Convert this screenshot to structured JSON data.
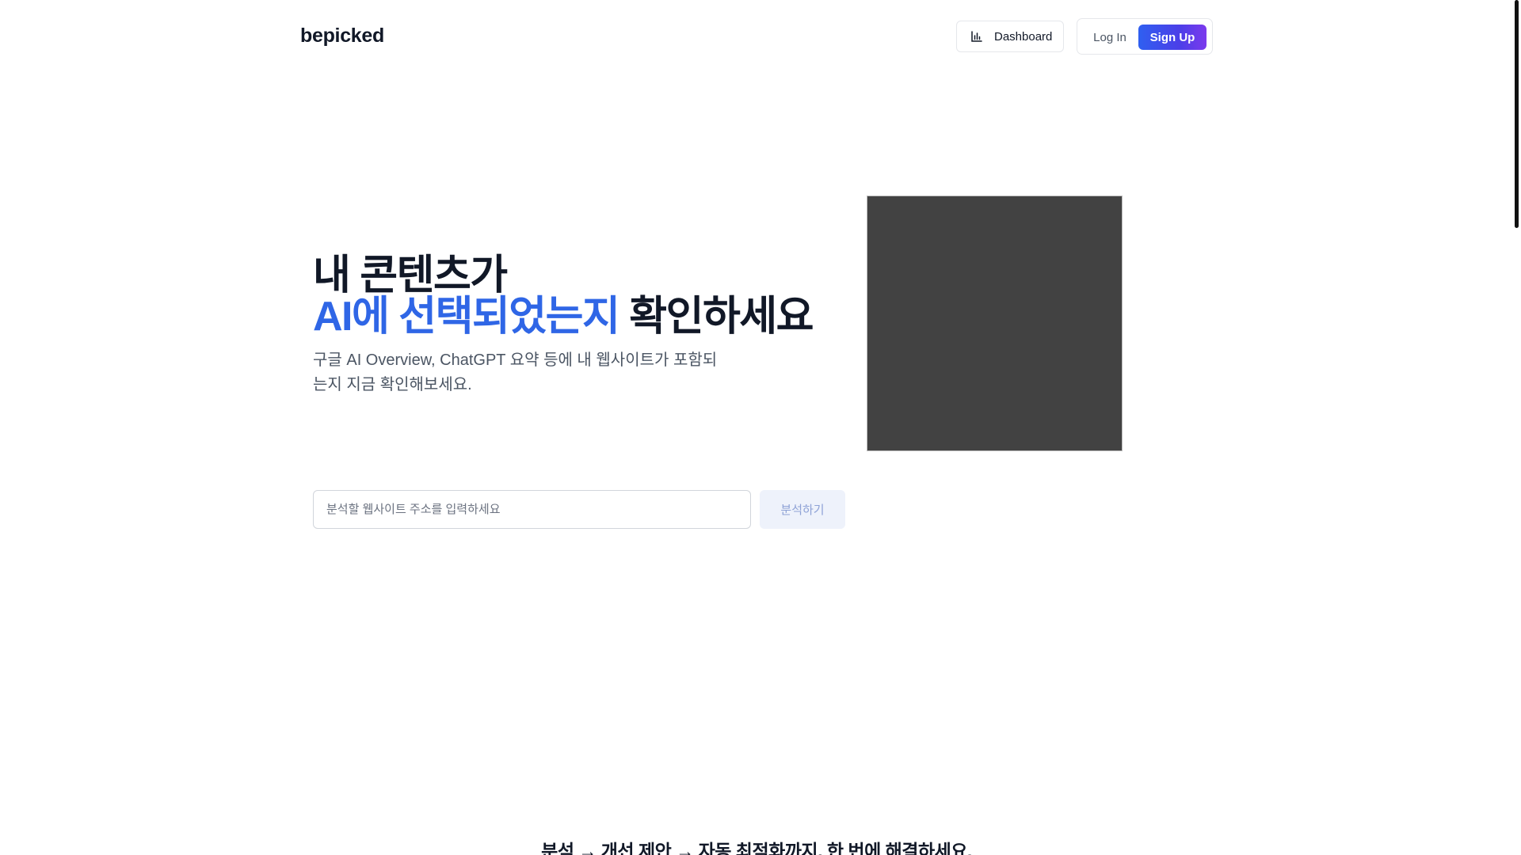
{
  "header": {
    "logo": "bepicked",
    "dashboard_label": "Dashboard",
    "dashboard_icon": "bar-chart-icon",
    "login_label": "Log In",
    "signup_label": "Sign Up"
  },
  "hero": {
    "title_line1": "내 콘텐츠가",
    "title_accent": "AI에 선택되었는지",
    "title_rest": "확인하세요",
    "subtitle_line1": "구글 AI Overview, ChatGPT 요약 등에 내 웹사이트가 포함되",
    "subtitle_line2": "는지 지금 확인해보세요."
  },
  "search": {
    "placeholder": "분석할 웹사이트 주소를 입력하세요",
    "value": "",
    "button_label": "분석하기"
  },
  "tagline": "분석 → 개선 제안 → 자동 최적화까지, 한 번에 해결하세요.",
  "colors": {
    "accent": "#2f66e6",
    "signup_gradient_start": "#2f5ff0",
    "signup_gradient_end": "#7c3aed",
    "image_placeholder": "#424242",
    "analyze_button_bg": "#eef2fb"
  }
}
